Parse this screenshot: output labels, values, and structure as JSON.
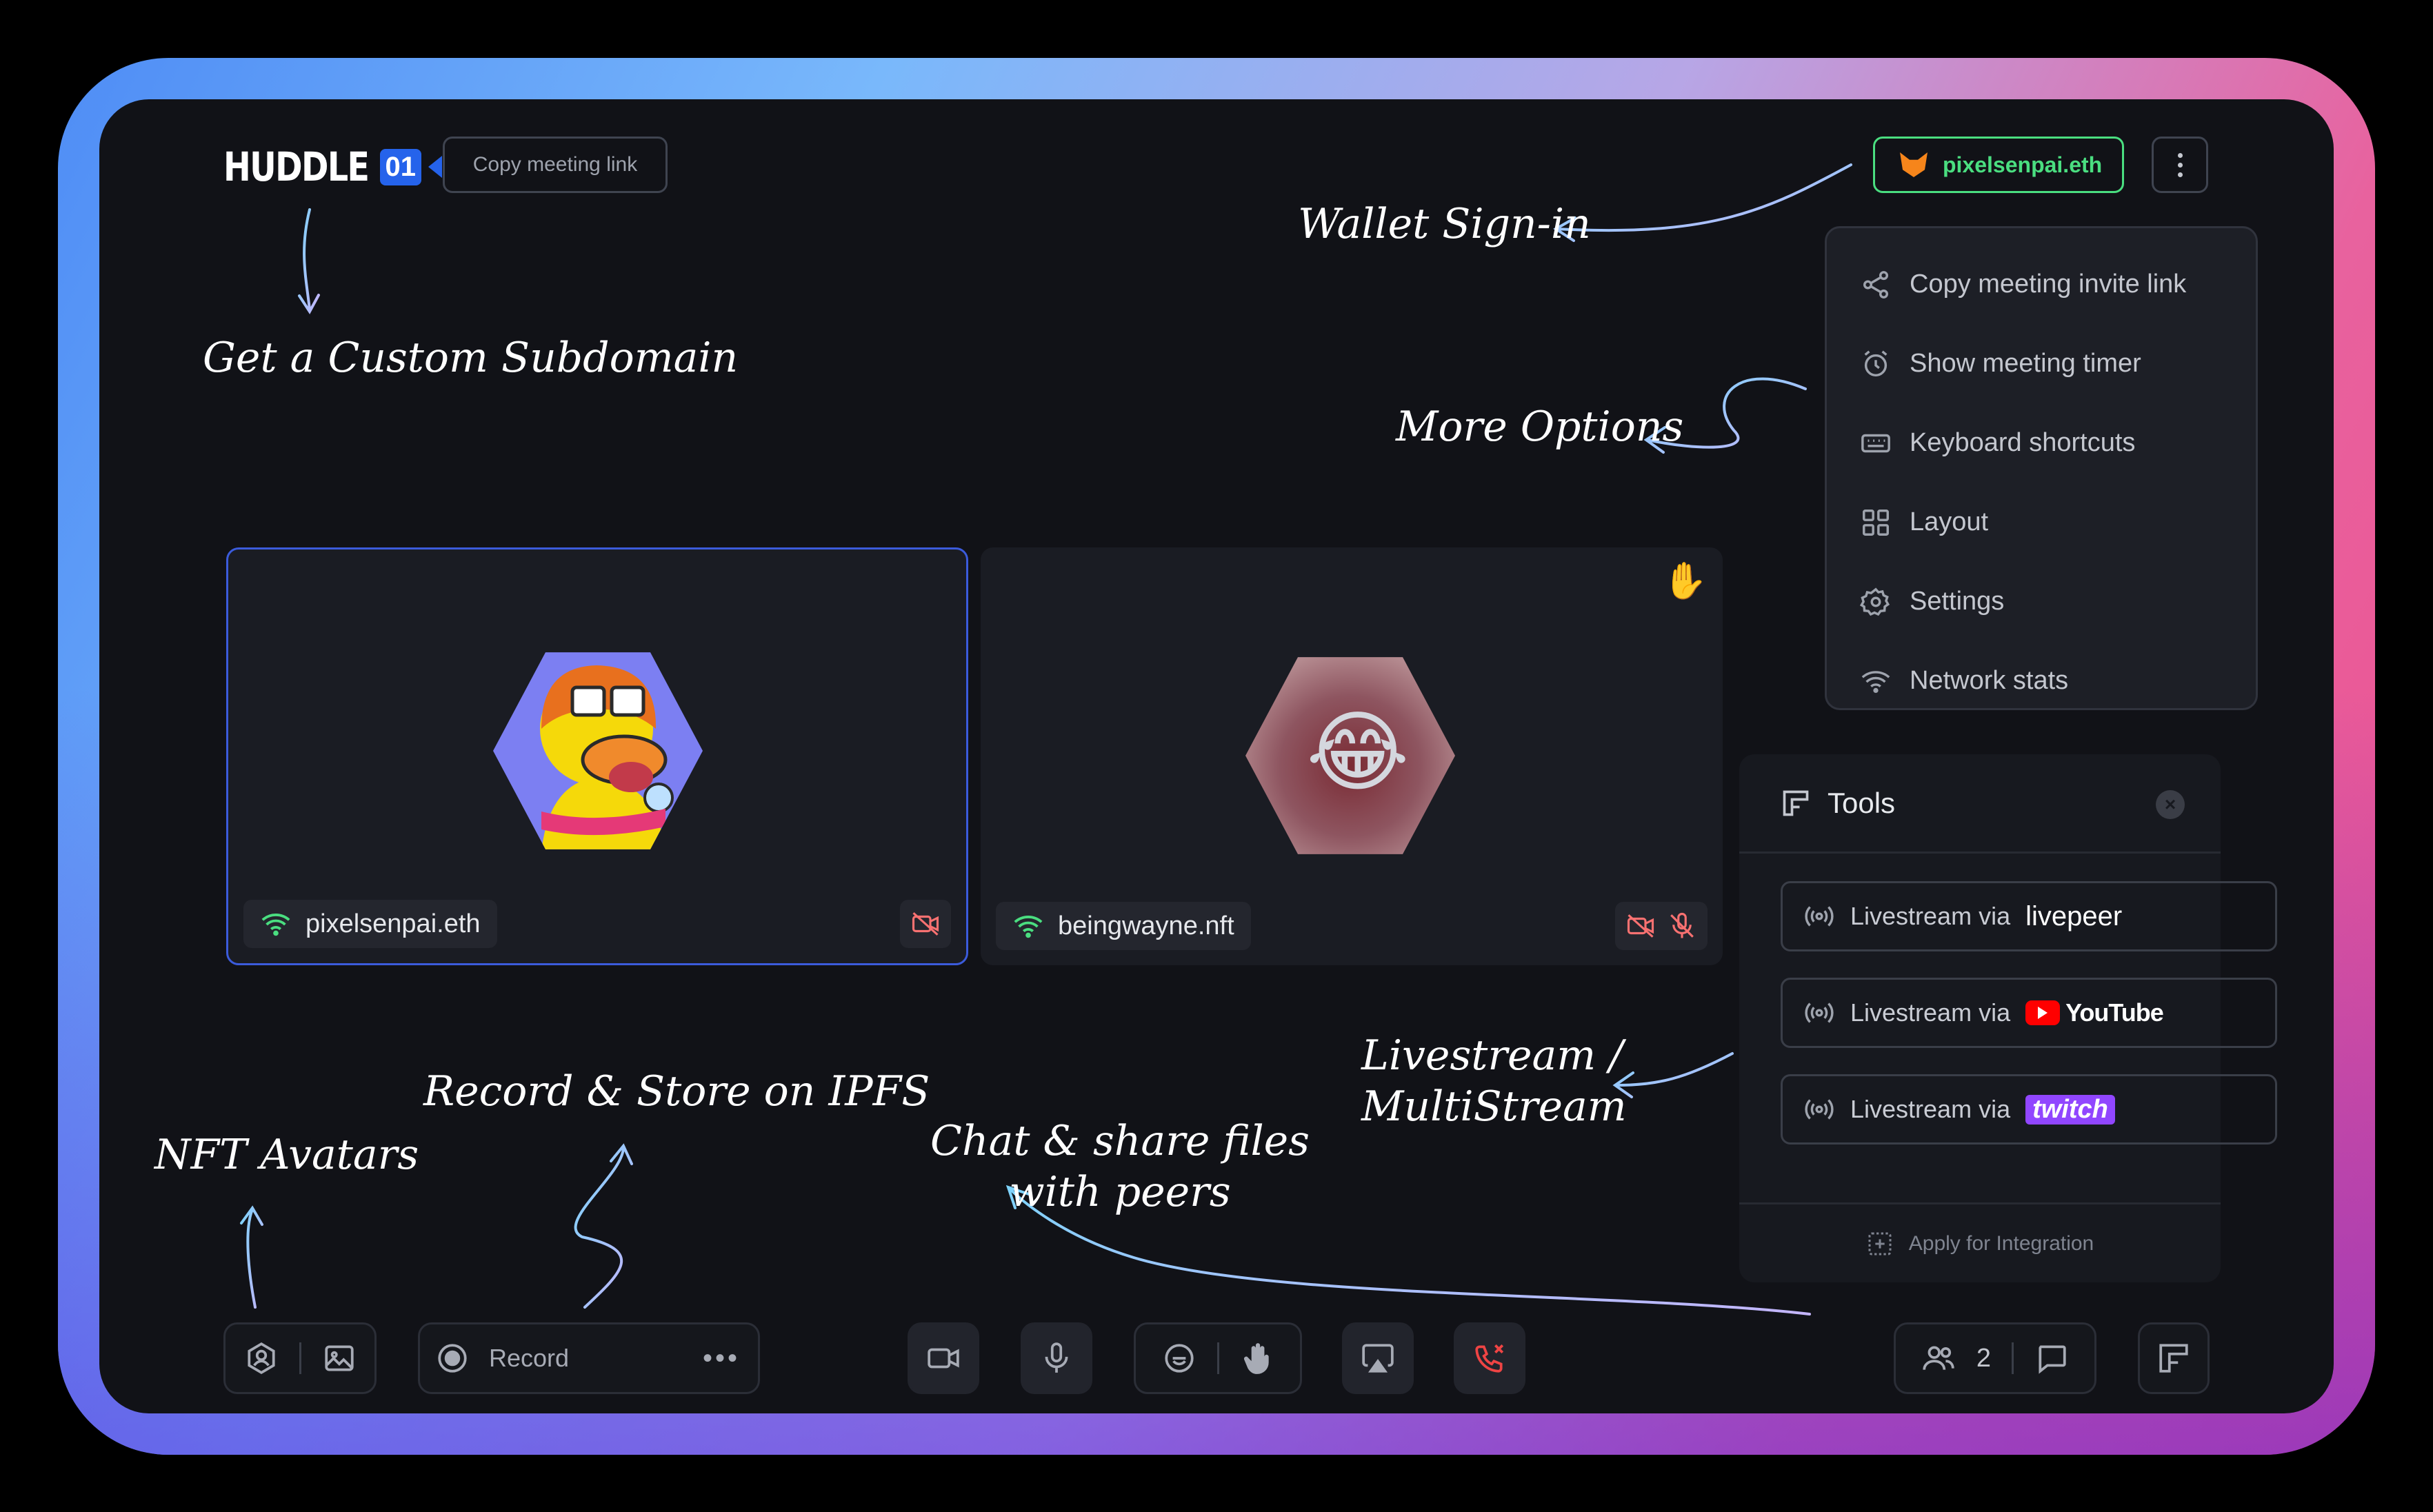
{
  "header": {
    "logo_text": "HUDDLE",
    "logo_badge": "01",
    "copy_link_label": "Copy meeting link",
    "wallet_label": "pixelsenpai.eth"
  },
  "menu": {
    "items": [
      {
        "icon": "share-icon",
        "label": "Copy meeting invite link"
      },
      {
        "icon": "alarm-clock-icon",
        "label": "Show meeting timer"
      },
      {
        "icon": "keyboard-icon",
        "label": "Keyboard shortcuts"
      },
      {
        "icon": "layout-grid-icon",
        "label": "Layout"
      },
      {
        "icon": "gear-icon",
        "label": "Settings"
      },
      {
        "icon": "wifi-icon",
        "label": "Network stats"
      }
    ]
  },
  "annotations": {
    "subdomain": "Get a Custom Subdomain",
    "wallet": "Wallet Sign-in",
    "more_options": "More Options",
    "livestream_line1": "Livestream /",
    "livestream_line2": "MultiStream",
    "record": "Record & Store on IPFS",
    "nft": "NFT Avatars",
    "chat_line1": "Chat & share files",
    "chat_line2": "with peers"
  },
  "participants": [
    {
      "name": "pixelsenpai.eth",
      "active": true,
      "camera_off": true,
      "mic_off": false,
      "hand_raised": false
    },
    {
      "name": "beingwayne.nft",
      "active": false,
      "camera_off": true,
      "mic_off": true,
      "hand_raised": true,
      "reaction": "😂"
    }
  ],
  "tools": {
    "title": "Tools",
    "livestream_prefix": "Livestream via",
    "services": [
      "livepeer",
      "YouTube",
      "twitch"
    ],
    "apply_label": "Apply for Integration"
  },
  "controls": {
    "record_label": "Record",
    "peer_count": "2"
  },
  "colors": {
    "accent_blue": "#2563eb",
    "wallet_green": "#4ade80",
    "end_call_red": "#ef4444",
    "background": "#111217"
  }
}
